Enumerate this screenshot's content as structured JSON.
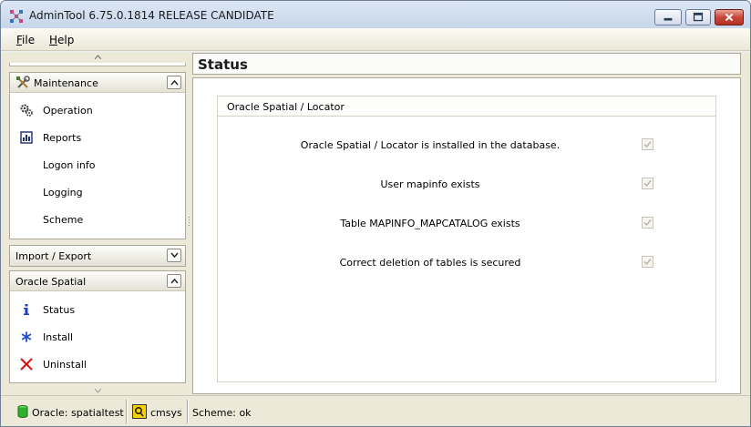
{
  "window": {
    "title": "AdminTool 6.75.0.1814 RELEASE CANDIDATE"
  },
  "menu": {
    "file": "File",
    "help": "Help"
  },
  "sidebar": {
    "maintenance": {
      "title": "Maintenance",
      "items": [
        {
          "label": "Operation",
          "icon": "gears-icon"
        },
        {
          "label": "Reports",
          "icon": "report-icon"
        },
        {
          "label": "Logon info"
        },
        {
          "label": "Logging"
        },
        {
          "label": "Scheme"
        }
      ]
    },
    "import_export": {
      "title": "Import / Export"
    },
    "oracle_spatial": {
      "title": "Oracle Spatial",
      "items": [
        {
          "label": "Status",
          "icon": "info-icon"
        },
        {
          "label": "Install",
          "icon": "asterisk-icon"
        },
        {
          "label": "Uninstall",
          "icon": "red-x-icon"
        }
      ]
    }
  },
  "content": {
    "title": "Status",
    "group_title": "Oracle Spatial / Locator",
    "checks": [
      {
        "label": "Oracle Spatial / Locator is installed in the database.",
        "checked": true
      },
      {
        "label": "User mapinfo exists",
        "checked": true
      },
      {
        "label": "Table MAPINFO_MAPCATALOG exists",
        "checked": true
      },
      {
        "label": "Correct deletion of tables is secured",
        "checked": true
      }
    ]
  },
  "statusbar": {
    "connection": "Oracle: spatialtest",
    "user": "cmsys",
    "scheme": "Scheme: ok"
  }
}
